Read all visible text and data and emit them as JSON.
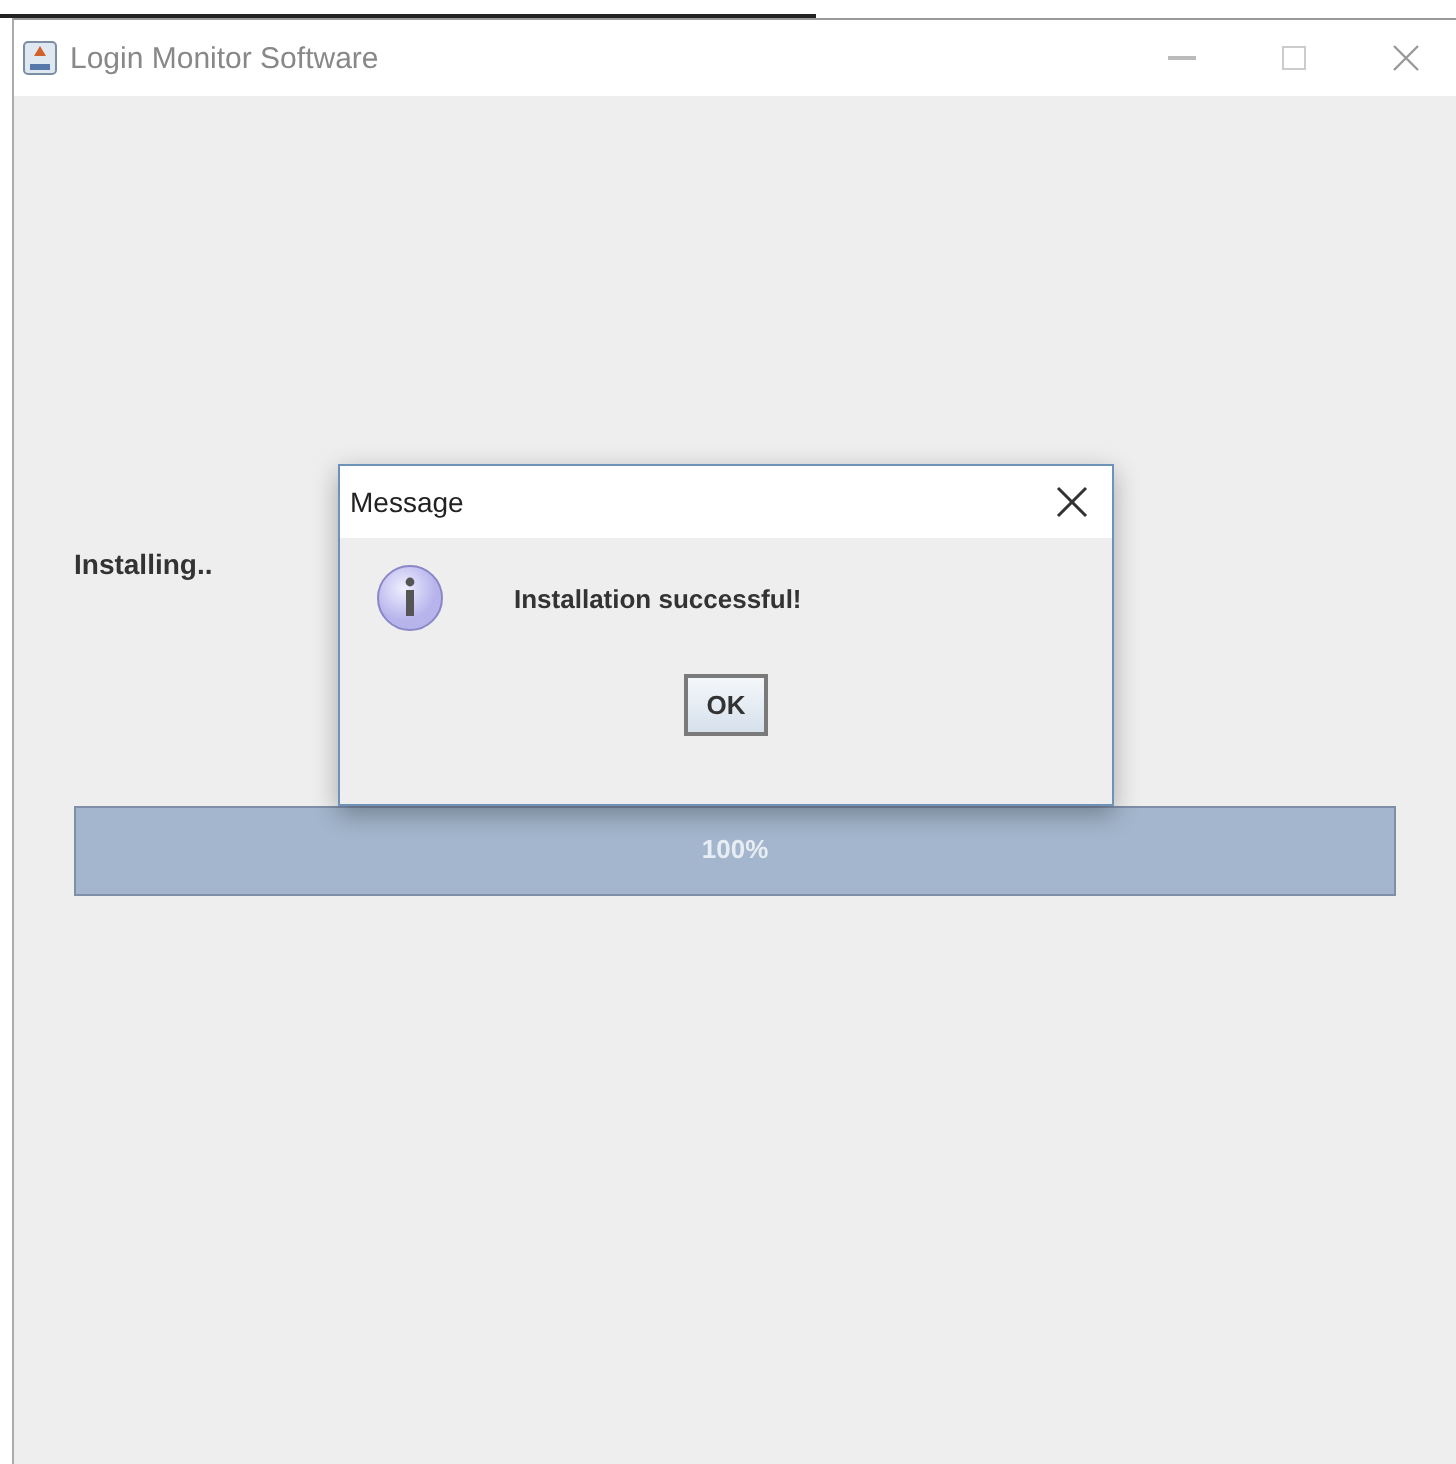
{
  "window": {
    "title": "Login Monitor Software"
  },
  "status_label": "Installing..",
  "progress": {
    "level": 1,
    "reading": "100%"
  },
  "dialog": {
    "title": "Message",
    "message": "Installation successful!",
    "buttons": [
      "OK"
    ]
  }
}
